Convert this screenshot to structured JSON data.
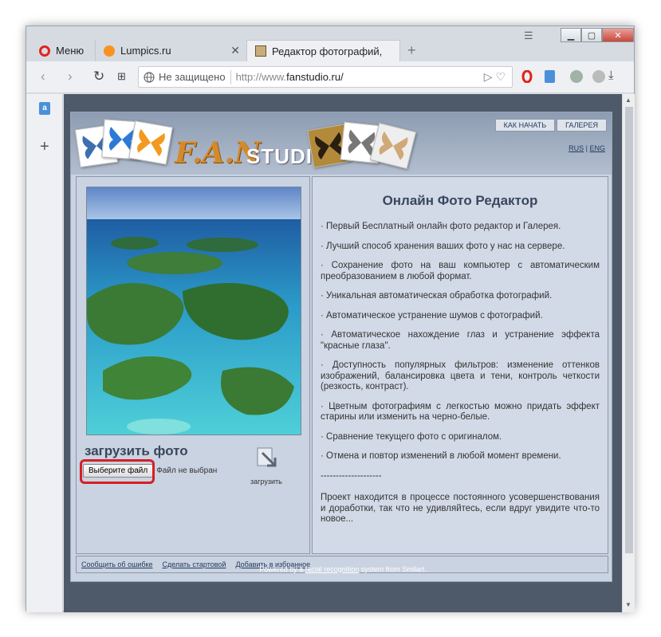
{
  "browser": {
    "tabs": [
      {
        "label": "Меню"
      },
      {
        "label": "Lumpics.ru"
      },
      {
        "label": "Редактор фотографий, об"
      }
    ],
    "url_security": "Не защищено",
    "url_prefix": "http://www.",
    "url_domain": "fanstudio.ru/",
    "new_tab_glyph": "+",
    "close_glyph": "✕",
    "icons": [
      "back-icon",
      "forward-icon",
      "reload-icon",
      "speed-dial-icon",
      "globe-icon",
      "send-icon",
      "heart-icon",
      "opera-icon",
      "translate-icon",
      "vpn-icon",
      "download-icon"
    ]
  },
  "site": {
    "logo_fan": "F.A.N",
    "logo_studio": "STUDIO",
    "nav": [
      "КАК НАЧАТЬ",
      "ГАЛЕРЕЯ"
    ],
    "lang_rus": "RUS",
    "lang_sep": "|",
    "lang_eng": "ENG",
    "upload_title": "загрузить фото",
    "file_button": "Выберите файл",
    "file_status": "Файл не выбран",
    "upload_label": "загрузить",
    "panel_title": "Онлайн Фото Редактор",
    "features": [
      "Первый Бесплатный онлайн фото редактор и Галерея.",
      "Лучший способ хранения ваших фото у нас на сервере.",
      "Сохранение фото на ваш компьютер с автоматическим преобразованием в любой формат.",
      "Уникальная автоматическая обработка фотографий.",
      "Автоматическое устранение шумов с фотографий.",
      "Автоматическое нахождение глаз и устранение эффекта \"красные глаза\".",
      "Доступность популярных фильтров: изменение оттенков изображений, балансировка цвета и тени, контроль четкости (резкость, контраст).",
      "Цветным фотографиям с легкостью можно придать эффект старины или изменить на черно-белые.",
      "Сравнение текущего фото с оригиналом.",
      "Отмена и повтор изменений в любой момент времени."
    ],
    "separator": "--------------------",
    "closing_text": "Проект находится в процессе постоянного усовершенствования и доработки, так что не удивляйтесь, если вдруг увидите что-то новое...",
    "footer_links": [
      "Сообщить об ошибке",
      "Сделать стартовой",
      "Добавить в избранное"
    ],
    "powered_pre": "Powered by a ",
    "powered_link": "facial recognition",
    "powered_post": " system from Smilart.",
    "colors": {
      "highlight": "#d61f26",
      "panel_bg": "#d2dae7",
      "page_bg": "#4e5a69"
    }
  }
}
